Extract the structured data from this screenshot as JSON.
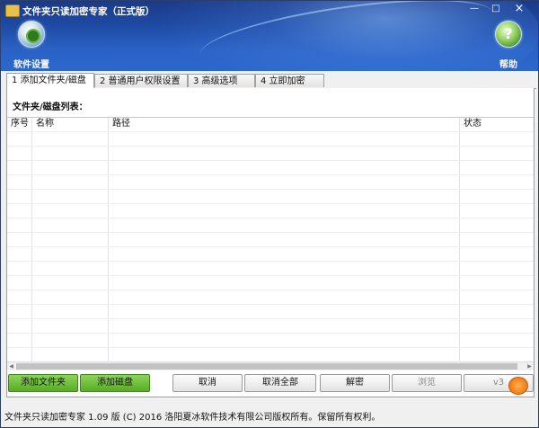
{
  "window": {
    "title": "文件夹只读加密专家（正式版）",
    "controls": {
      "minimize": "—",
      "maximize": "□",
      "close": "×"
    }
  },
  "toolbar": {
    "settings_label": "软件设置",
    "settings_icon": "gear-icon",
    "help_label": "帮助",
    "help_icon": "help-icon",
    "help_glyph": "?"
  },
  "tabs": [
    {
      "label": "1 添加文件夹/磁盘",
      "active": true
    },
    {
      "label": "2 普通用户权限设置",
      "active": false
    },
    {
      "label": "3 高级选项",
      "active": false
    },
    {
      "label": "4 立即加密",
      "active": false
    }
  ],
  "list": {
    "title": "文件夹/磁盘列表：",
    "columns": [
      "序号",
      "名称",
      "路径",
      "状态"
    ],
    "rows": []
  },
  "buttons": {
    "add_folder": "添加文件夹",
    "add_disk": "添加磁盘",
    "cancel": "取消",
    "cancel_all": "取消全部",
    "decrypt": "解密",
    "browse": "浏览",
    "extra": "v3"
  },
  "status_bar": {
    "text": "文件夹只读加密专家 1.09 版 (C) 2016 洛阳夏冰软件技术有限公司版权所有。保留所有权利。"
  },
  "colors": {
    "header": "#1e4aa4",
    "green_button": "#56ad24"
  }
}
